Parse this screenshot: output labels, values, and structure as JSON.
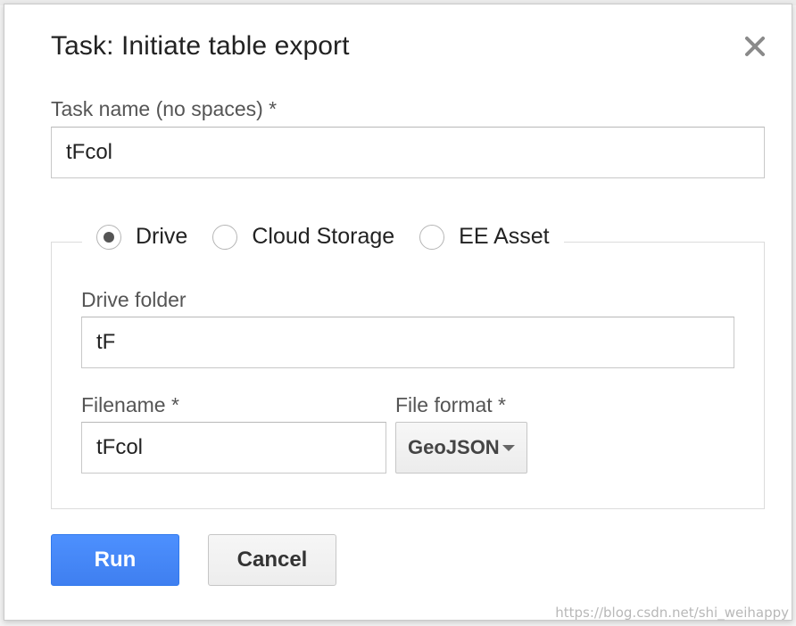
{
  "dialog": {
    "title": "Task: Initiate table export",
    "close_icon": "close-icon"
  },
  "task_name": {
    "label": "Task name (no spaces) *",
    "value": "tFcol"
  },
  "destination": {
    "options": [
      {
        "label": "Drive",
        "checked": true
      },
      {
        "label": "Cloud Storage",
        "checked": false
      },
      {
        "label": "EE Asset",
        "checked": false
      }
    ]
  },
  "drive_folder": {
    "label": "Drive folder",
    "value": "tF"
  },
  "filename": {
    "label": "Filename *",
    "value": "tFcol"
  },
  "file_format": {
    "label": "File format *",
    "selected": "GeoJSON"
  },
  "buttons": {
    "run": "Run",
    "cancel": "Cancel"
  },
  "watermark": "https://blog.csdn.net/shi_weihappy",
  "colors": {
    "run_button": "#4d90fe",
    "radio_checked_dot": "#555555"
  }
}
